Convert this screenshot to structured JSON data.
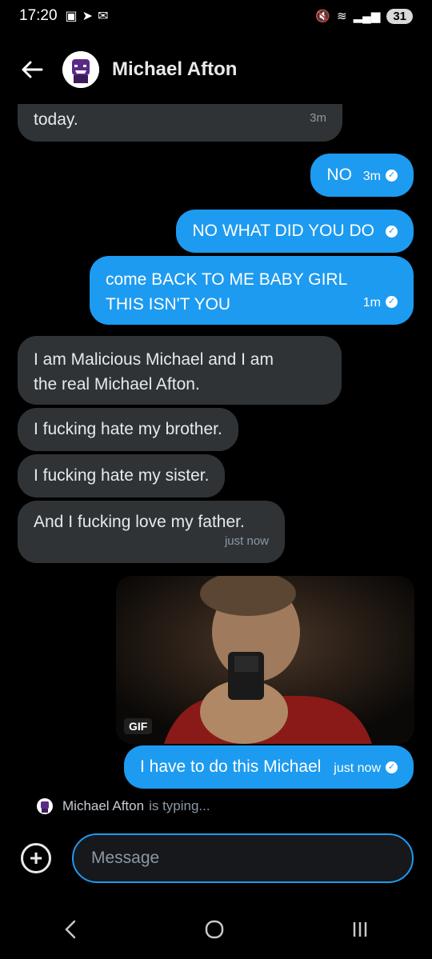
{
  "status_bar": {
    "time": "17:20",
    "battery": "31"
  },
  "header": {
    "title": "Michael Afton"
  },
  "messages": [
    {
      "text": "today.",
      "time": "3m"
    },
    {
      "text": "NO",
      "time": "3m"
    },
    {
      "text": "NO WHAT DID YOU DO"
    },
    {
      "line1": "come BACK TO ME BABY GIRL",
      "line2": "THIS ISN'T YOU",
      "time": "1m"
    },
    {
      "line1": "I am Malicious Michael and I am",
      "line2": "the real Michael Afton."
    },
    {
      "text": "I fucking hate my brother."
    },
    {
      "text": "I fucking hate my sister."
    },
    {
      "text": "And I fucking love my father.",
      "time": "just now"
    },
    {
      "gif_badge": "GIF"
    },
    {
      "text": "I have to do this Michael",
      "time": "just now"
    }
  ],
  "typing": {
    "name": "Michael Afton",
    "status": "is typing..."
  },
  "composer": {
    "placeholder": "Message"
  },
  "colors": {
    "accent": "#1d9bf0",
    "incoming_bubble": "#2f3336",
    "background": "#000000"
  }
}
